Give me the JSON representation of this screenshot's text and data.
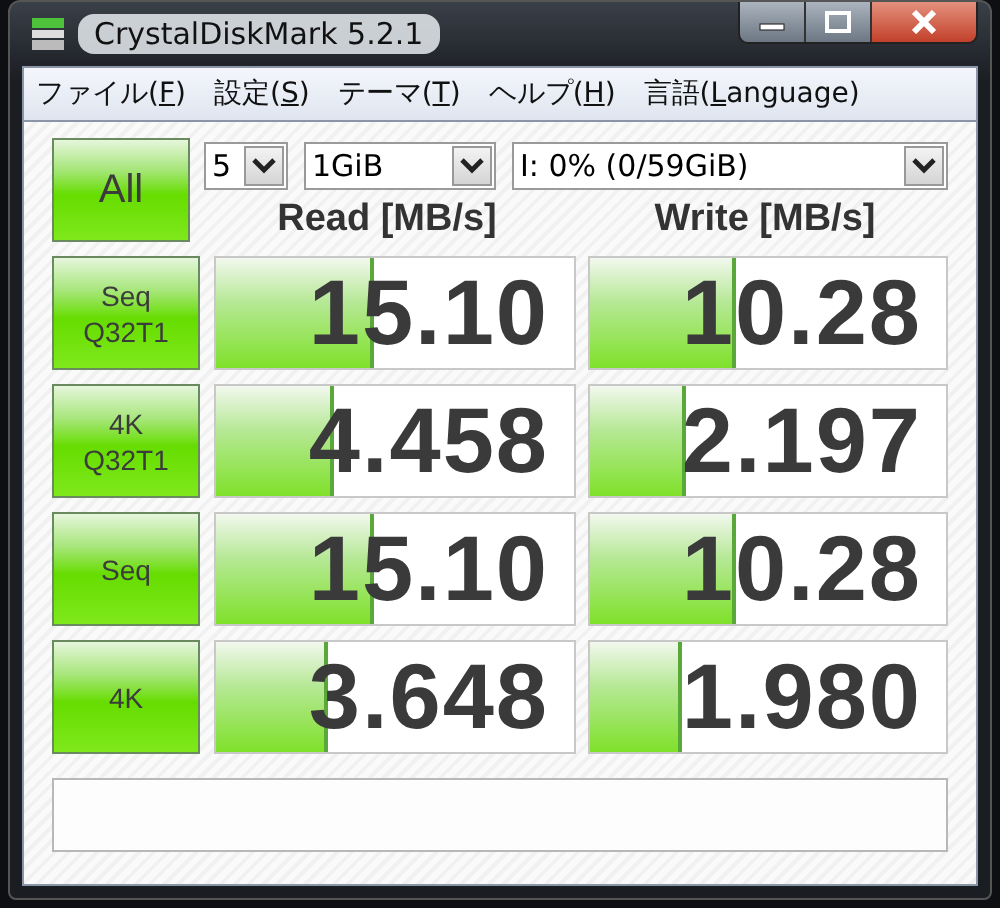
{
  "window": {
    "title": "CrystalDiskMark 5.2.1"
  },
  "menu": [
    {
      "label": "ファイル(",
      "key": "F",
      "end": ")"
    },
    {
      "label": "設定(",
      "key": "S",
      "end": ")"
    },
    {
      "label": "テーマ(",
      "key": "T",
      "end": ")"
    },
    {
      "label": "ヘルプ(",
      "key": "H",
      "end": ")"
    },
    {
      "label": "言語(",
      "key": "L",
      "end": "anguage)"
    }
  ],
  "all_button": "All",
  "selectors": [
    {
      "value": "5"
    },
    {
      "value": "1GiB"
    },
    {
      "value": "I: 0% (0/59GiB)"
    }
  ],
  "columns": [
    "Read [MB/s]",
    "Write [MB/s]"
  ],
  "rows": [
    {
      "test": [
        "Seq",
        "Q32T1"
      ],
      "read": {
        "value": "15.10",
        "level": 0.43
      },
      "write": {
        "value": "10.28",
        "level": 0.4
      }
    },
    {
      "test": [
        "4K",
        "Q32T1"
      ],
      "read": {
        "value": "4.458",
        "level": 0.32
      },
      "write": {
        "value": "2.197",
        "level": 0.26
      }
    },
    {
      "test": [
        "Seq"
      ],
      "read": {
        "value": "15.10",
        "level": 0.43
      },
      "write": {
        "value": "10.28",
        "level": 0.4
      }
    },
    {
      "test": [
        "4K"
      ],
      "read": {
        "value": "3.648",
        "level": 0.3
      },
      "write": {
        "value": "1.980",
        "level": 0.25
      }
    }
  ]
}
